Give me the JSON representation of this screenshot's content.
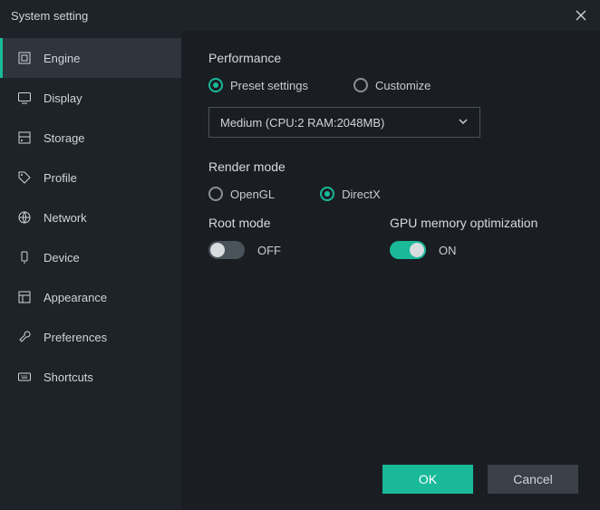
{
  "window": {
    "title": "System setting"
  },
  "sidebar": {
    "items": [
      {
        "label": "Engine",
        "icon": "engine-icon",
        "active": true
      },
      {
        "label": "Display",
        "icon": "display-icon",
        "active": false
      },
      {
        "label": "Storage",
        "icon": "storage-icon",
        "active": false
      },
      {
        "label": "Profile",
        "icon": "tag-icon",
        "active": false
      },
      {
        "label": "Network",
        "icon": "globe-icon",
        "active": false
      },
      {
        "label": "Device",
        "icon": "device-icon",
        "active": false
      },
      {
        "label": "Appearance",
        "icon": "appearance-icon",
        "active": false
      },
      {
        "label": "Preferences",
        "icon": "wrench-icon",
        "active": false
      },
      {
        "label": "Shortcuts",
        "icon": "keyboard-icon",
        "active": false
      }
    ]
  },
  "main": {
    "performance": {
      "title": "Performance",
      "preset_label": "Preset settings",
      "customize_label": "Customize",
      "selected": "preset",
      "dropdown_value": "Medium (CPU:2 RAM:2048MB)"
    },
    "render": {
      "title": "Render mode",
      "opengl_label": "OpenGL",
      "directx_label": "DirectX",
      "selected": "directx"
    },
    "root": {
      "title": "Root mode",
      "state_label": "OFF",
      "on": false
    },
    "gpu": {
      "title": "GPU memory optimization",
      "state_label": "ON",
      "on": true
    }
  },
  "footer": {
    "ok_label": "OK",
    "cancel_label": "Cancel"
  }
}
